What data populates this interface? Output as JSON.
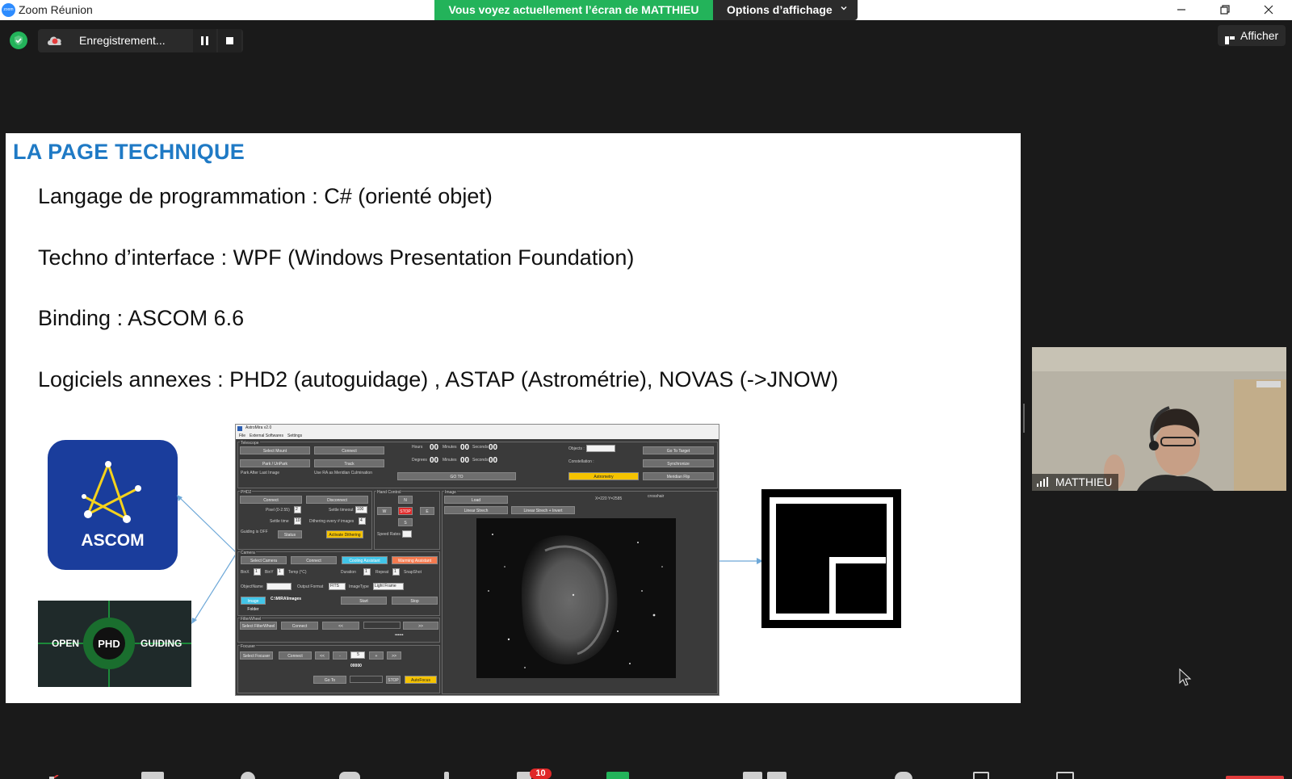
{
  "window": {
    "title": "Zoom Réunion",
    "logo_text": "zoom"
  },
  "share_banner": {
    "text": "Vous voyez actuellement l’écran de MATTHIEU",
    "options_label": "Options d’affichage"
  },
  "recording": {
    "label": "Enregistrement..."
  },
  "afficher_label": "Afficher",
  "slide": {
    "title": "LA PAGE TECHNIQUE",
    "lines": [
      "Langage de programmation  : C# (orienté objet)",
      "Techno d’interface : WPF (Windows Presentation Foundation)",
      "Binding : ASCOM 6.6",
      "Logiciels annexes : PHD2 (autoguidage) , ASTAP (Astrométrie), NOVAS (->JNOW)"
    ],
    "ascom_label": "ASCOM",
    "phd_left": "OPEN",
    "phd_center": "PHD",
    "phd_right": "GUIDING",
    "app": {
      "title": "AstroMira v2.0",
      "menu": [
        "File",
        "External Softwares",
        "Settings"
      ],
      "telescope_label": "Telescope",
      "select_mount": "Select Mount",
      "connect": "Connect",
      "park": "Park / UnPark",
      "track": "Track",
      "park_after": "Park After Last Image",
      "use_ra": "Use RA as Meridian Culmination",
      "hours": "Hours",
      "minutes": "Minutes",
      "seconds": "Seconds",
      "degrees": "Degrees",
      "zero": "00",
      "goto": "GO TO",
      "objects": "Objects :",
      "constellation": "Constellation :",
      "go_to_target": "Go To Target",
      "synchronize": "Synchronize",
      "astrometry": "Astrometry",
      "meridian_flip": "Meridian Flip",
      "phd2_label": "PHD2",
      "disconnect": "Disconnect",
      "pixel": "Pixel (0-2.55)",
      "pixel_val": "2",
      "settle_timeout": "Settle timeout",
      "settle_timeout_val": "100",
      "settle_time": "Settle time",
      "settle_time_val": "10",
      "dithering": "Dithering every # images",
      "dithering_val": "4",
      "guiding_off": "Guiding is OFF",
      "status": "Status",
      "activate_dithering": "Activate Dithering",
      "hand_control": "Hand Control",
      "n": "N",
      "w": "W",
      "stop_small": "STOP",
      "e": "E",
      "s": "S",
      "speed_rates": "Speed Rates",
      "image_label": "Image",
      "load": "Load",
      "linear_stretch": "Linear Strech",
      "linear_stretch_invert": "Linear Strech + Invert",
      "crosshair": "crosshair",
      "coords": "X=220 Y=2585",
      "camera_label": "Camera",
      "select_camera": "Select Camera",
      "cooling_assistant": "Cooling Assistant",
      "warming_assistant": "Warming Assistant",
      "binx": "BinX",
      "biny": "BinY",
      "bin_val": "1",
      "temp": "Temp (°C)",
      "duration": "Duration",
      "duration_val": "1",
      "repeat": "Repeat",
      "repeat_val": "1",
      "snapshot": "SnapShot",
      "object_name": "ObjectName",
      "output_format": "Output Format",
      "output_format_val": "FITS",
      "image_type": "ImageType",
      "image_type_val": "Light Frame",
      "image_folder": "Image Folder",
      "image_folder_path": "C:\\MIRA\\Images",
      "start": "Start",
      "stop": "Stop",
      "filterwheel_label": "FilterWheel",
      "select_filterwheel": "Select FilterWheel",
      "prev": "<<",
      "next": ">>",
      "dashes": "••••••",
      "focuser_label": "Focuser",
      "select_focuser": "Select Focuser",
      "minus": "-",
      "plus": "+",
      "focus_val": "5",
      "focus_pos": "00000",
      "goto_small": "Go To",
      "stop_upper": "STOP",
      "autofocus": "AutoFocus"
    }
  },
  "participant": {
    "name": "MATTHIEU"
  },
  "toolbar": {
    "chat_badge": "10"
  },
  "colors": {
    "share_green": "#23b35a",
    "title_blue": "#1f7ac5",
    "ascom_blue": "#1a3d9c",
    "zoom_blue": "#2d8cff"
  }
}
